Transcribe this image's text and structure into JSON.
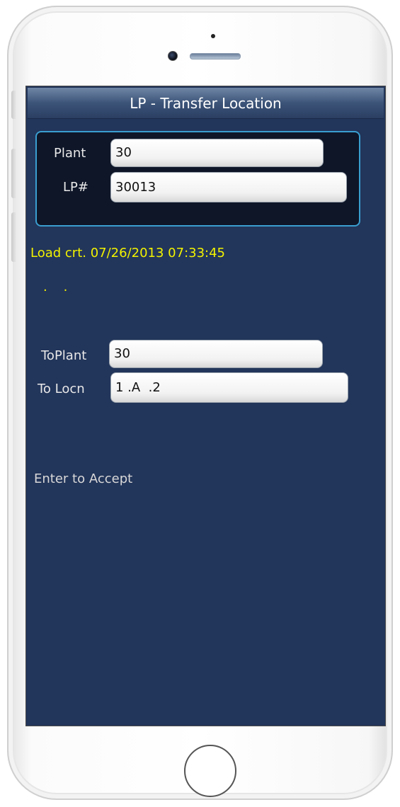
{
  "header": {
    "title": "LP - Transfer Location"
  },
  "lp_section": {
    "plant_label": "Plant",
    "plant_value": "30",
    "lp_label": "LP#",
    "lp_value": "30013"
  },
  "status": {
    "load_line": "Load crt. 07/26/2013 07:33:45",
    "dots_line": ".    ."
  },
  "transfer": {
    "to_plant_label": "ToPlant",
    "to_plant_value": "30",
    "to_locn_label": "To Locn",
    "to_locn_value": "1 .A  .2"
  },
  "footer": {
    "hint": "Enter to Accept"
  },
  "colors": {
    "screen_bg": "#22355a",
    "accent_border": "#3a9ed0",
    "status_text": "#f2f200"
  }
}
